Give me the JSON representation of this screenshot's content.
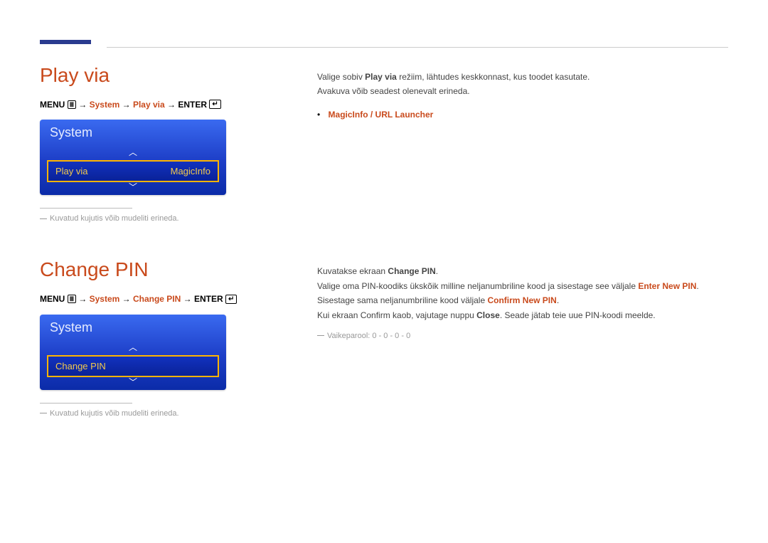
{
  "sections": {
    "playvia": {
      "heading": "Play via",
      "bc_menu": "MENU",
      "bc_arrow1": " → ",
      "bc_system": "System",
      "bc_arrow2": " → ",
      "bc_playvia": "Play via",
      "bc_arrow3": " → ",
      "bc_enter": "ENTER",
      "panel_title": "System",
      "item_label": "Play via",
      "item_value": "MagicInfo",
      "footnote": "Kuvatud kujutis võib mudeliti erineda.",
      "p1_a": "Valige sobiv ",
      "p1_b": "Play via",
      "p1_c": " režiim, lähtudes keskkonnast, kus toodet kasutate.",
      "p2": "Avakuva võib seadest olenevalt erineda.",
      "bullet": "MagicInfo / URL Launcher"
    },
    "changepin": {
      "heading": "Change PIN",
      "bc_menu": "MENU",
      "bc_arrow1": " → ",
      "bc_system": "System",
      "bc_arrow2": " → ",
      "bc_changepin": "Change PIN",
      "bc_arrow3": " → ",
      "bc_enter": "ENTER",
      "panel_title": "System",
      "item_label": "Change PIN",
      "footnote": "Kuvatud kujutis võib mudeliti erineda.",
      "r1_a": "Kuvatakse ekraan ",
      "r1_b": "Change PIN",
      "r1_c": ".",
      "r2_a": "Valige oma PIN-koodiks ükskõik milline neljanumbriline kood ja sisestage see väljale ",
      "r2_b": "Enter New PIN",
      "r2_c": ". Sisestage sama neljanumbriline kood väljale ",
      "r2_d": "Confirm New PIN",
      "r2_e": ".",
      "r3_a": "Kui ekraan Confirm kaob, vajutage nuppu ",
      "r3_b": "Close",
      "r3_c": ". Seade jätab teie uue PIN-koodi meelde.",
      "tip": "Vaikeparool: 0 - 0 - 0 - 0"
    }
  }
}
